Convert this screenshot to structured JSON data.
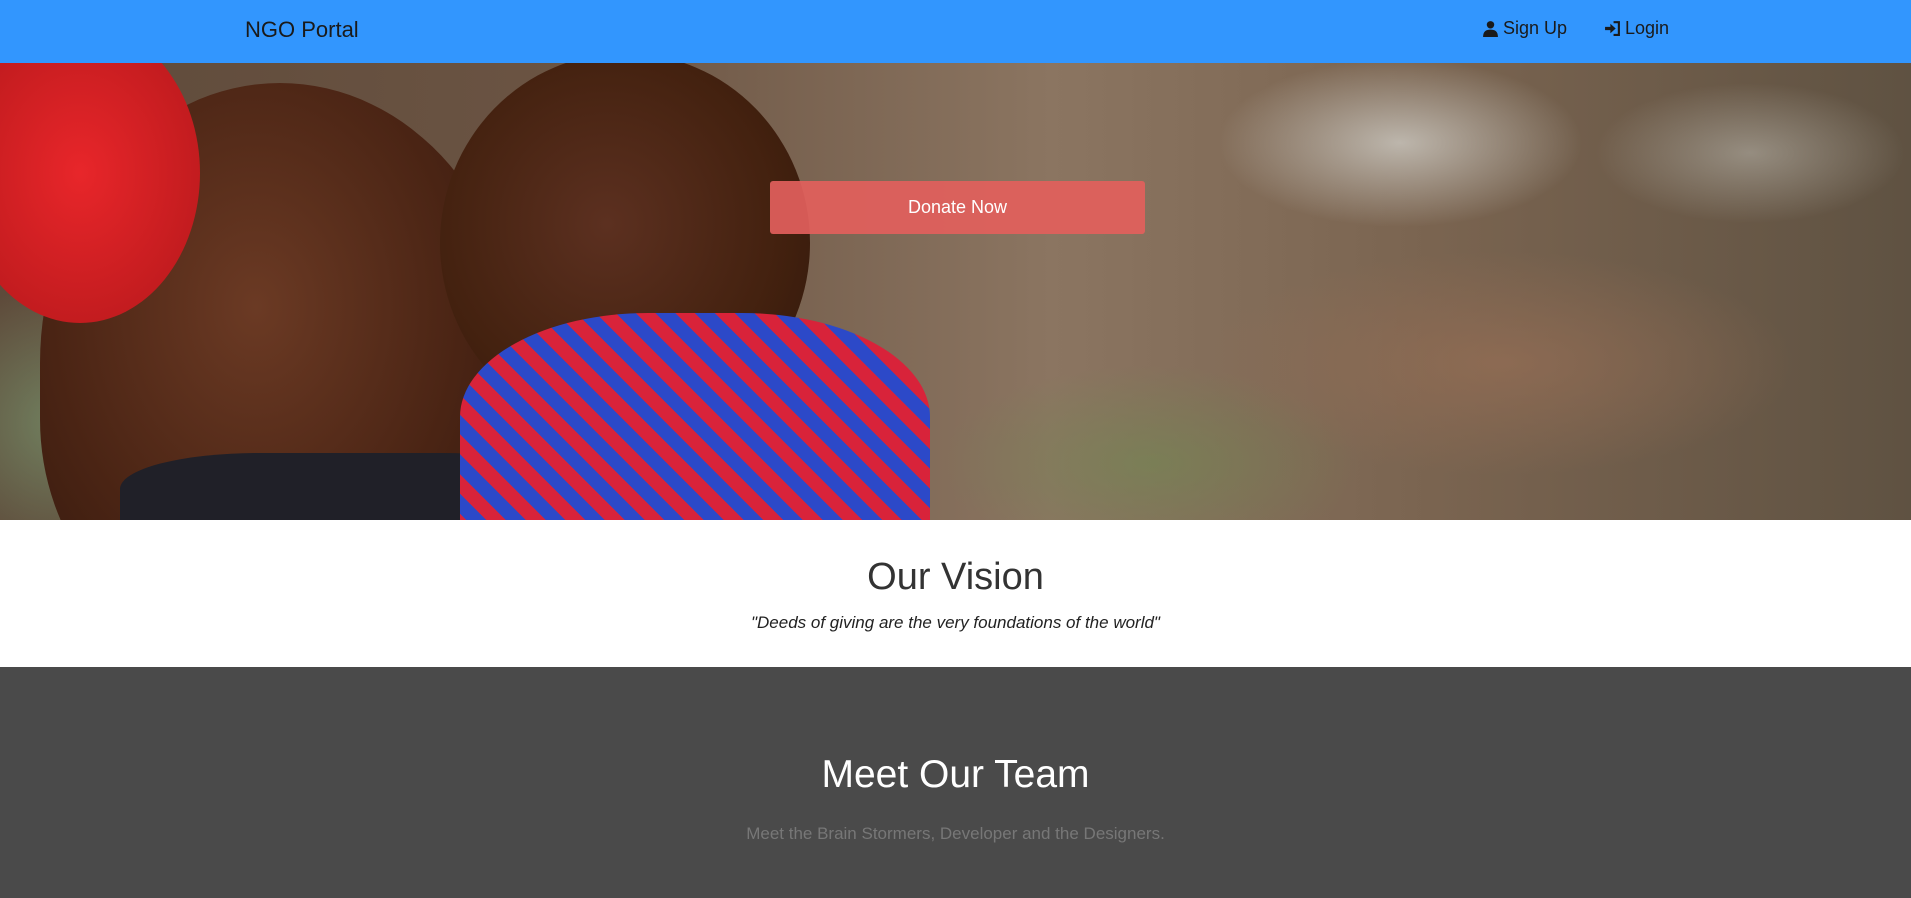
{
  "navbar": {
    "brand": "NGO Portal",
    "signup_label": "Sign Up",
    "signup_icon": "user-icon",
    "login_label": "Login",
    "login_icon": "login-icon",
    "background_color": "#3296fe"
  },
  "hero": {
    "donate_label": "Donate Now",
    "donate_color": "#e25f5c"
  },
  "vision": {
    "title": "Our Vision",
    "quote": "\"Deeds of giving are the very foundations of the world\""
  },
  "team": {
    "title": "Meet Our Team",
    "subtitle": "Meet the Brain Stormers, Developer and the Designers.",
    "background_color": "#4a4a4a"
  }
}
